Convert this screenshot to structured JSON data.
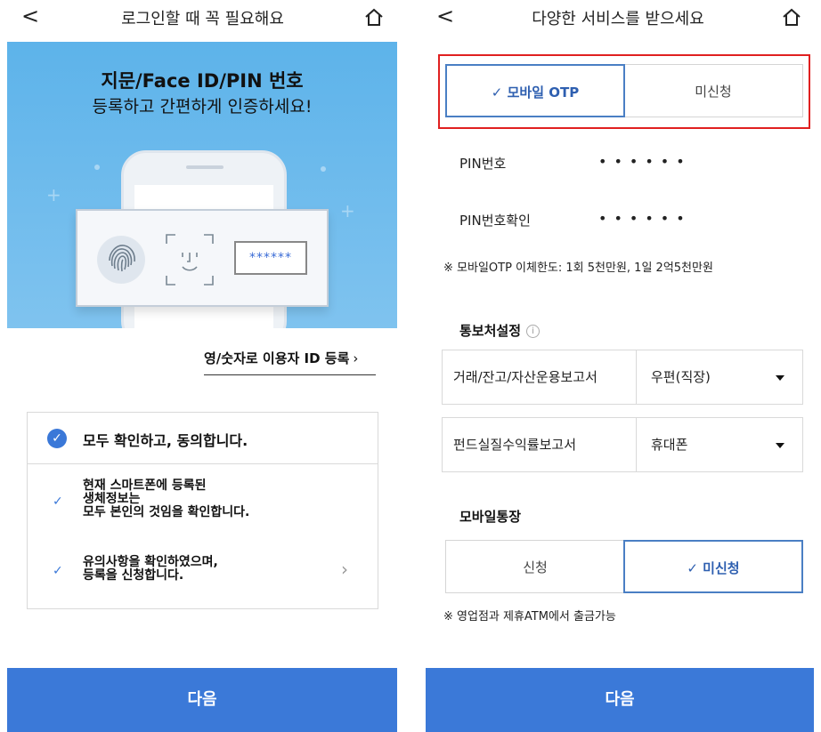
{
  "left": {
    "header_title": "로그인할 때 꼭 필요해요",
    "back_glyph": "<",
    "banner": {
      "title": "지문/Face ID/PIN 번호",
      "subtitle": "등록하고 간편하게 인증하세요!",
      "pin_mask": "******"
    },
    "id_link": "영/숫자로 이용자 ID 등록",
    "id_link_chevron": "›",
    "consent": {
      "all_label": "모두 확인하고, 동의합니다.",
      "items": [
        {
          "text": "현재 스마트폰에 등록된\n생체정보는\n모두 본인의 것임을 확인합니다."
        },
        {
          "text": "유의사항을 확인하였으며,\n등록을 신청합니다."
        }
      ],
      "check_glyph": "✓",
      "arrow_glyph": "›"
    },
    "next_button": "다음"
  },
  "right": {
    "header_title": "다양한 서비스를 받으세요",
    "back_glyph": "<",
    "otp_toggle": {
      "selected": "✓ 모바일 OTP",
      "other": "미신청"
    },
    "pin_label": "PIN번호",
    "pin_confirm_label": "PIN번호확인",
    "pin_dots": "••••••",
    "limit_note": "※ 모바일OTP 이체한도: 1회 5천만원, 1일 2억5천만원",
    "notify_section": "통보처설정",
    "info_glyph": "i",
    "notify_rows": [
      {
        "label": "거래/잔고/자산운용보고서",
        "value": "우편(직장)"
      },
      {
        "label": "펀드실질수익률보고서",
        "value": "휴대폰"
      }
    ],
    "passbook_section": "모바일통장",
    "passbook_toggle": {
      "other": "신청",
      "selected": "✓ 미신청"
    },
    "atm_note": "※ 영업점과 제휴ATM에서 출금가능",
    "next_button": "다음"
  },
  "colors": {
    "accent": "#3b79d8",
    "highlight_border": "#e02020",
    "banner_blue": "#5db3ea"
  },
  "icons": [
    "back-icon",
    "home-icon",
    "fingerprint-icon",
    "face-id-icon",
    "check-circle-icon",
    "check-icon",
    "chevron-right-icon",
    "info-icon",
    "dropdown-caret-icon"
  ]
}
